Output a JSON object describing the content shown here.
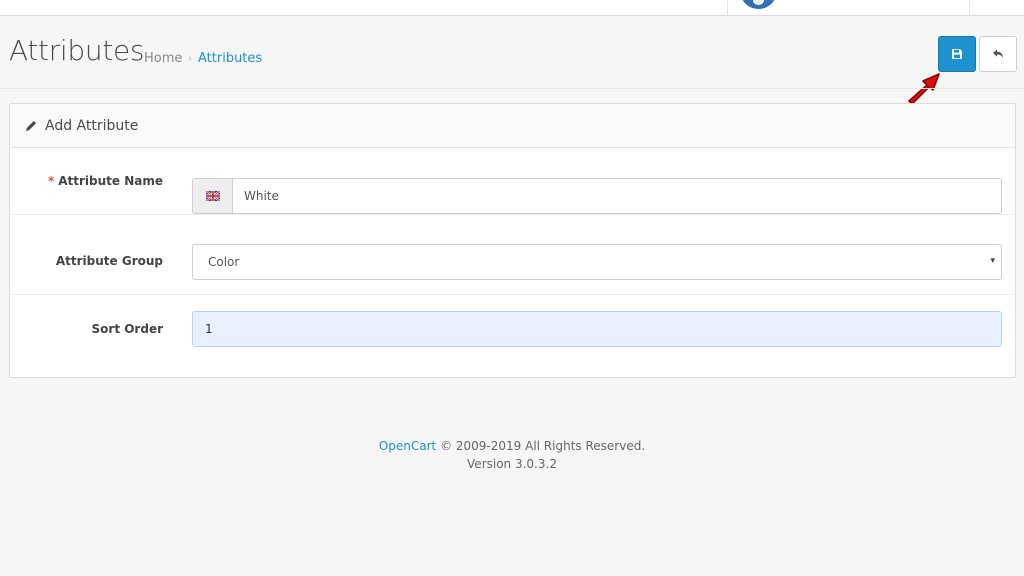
{
  "header": {
    "title": "Attributes",
    "breadcrumb": [
      {
        "label": "Home"
      },
      {
        "label": "Attributes"
      }
    ],
    "breadcrumb_separator": "›",
    "buttons": {
      "save_icon": "floppy-disk-icon",
      "back_icon": "reply-arrow-icon"
    }
  },
  "panel": {
    "title": "Add Attribute",
    "title_icon": "pencil-icon"
  },
  "form": {
    "attribute_name": {
      "required_mark": "*",
      "label": "Attribute Name",
      "flag_icon": "uk-flag-icon",
      "value": "White"
    },
    "attribute_group": {
      "label": "Attribute Group",
      "selected": "Color",
      "caret": "▾"
    },
    "sort_order": {
      "label": "Sort Order",
      "value": "1"
    }
  },
  "footer": {
    "brand": "OpenCart",
    "copyright": " © 2009-2019 All Rights Reserved.",
    "version": "Version 3.0.3.2"
  },
  "colors": {
    "primary": "#1e91cf",
    "required": "#e3503e",
    "annotation_arrow": "#e01010"
  }
}
